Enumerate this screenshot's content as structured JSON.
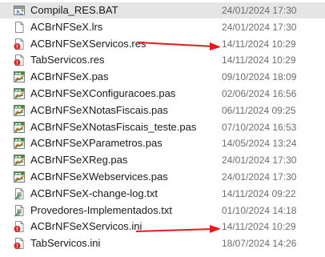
{
  "files": [
    {
      "name": "Compila_RES.BAT",
      "modified": "24/01/2024 17:30",
      "icon": "batch-file-icon",
      "selected": true
    },
    {
      "name": "ACBrNFSeX.lrs",
      "modified": "24/01/2024 17:30",
      "icon": "lrs-file-icon",
      "selected": false
    },
    {
      "name": "ACBrNFSeXServicos.res",
      "modified": "14/11/2024 10:29",
      "icon": "resource-file-icon",
      "selected": false
    },
    {
      "name": "TabServicos.res",
      "modified": "14/11/2024 10:29",
      "icon": "resource-file-icon",
      "selected": false
    },
    {
      "name": "ACBrNFSeX.pas",
      "modified": "09/10/2024 18:09",
      "icon": "pascal-file-icon",
      "selected": false
    },
    {
      "name": "ACBrNFSeXConfiguracoes.pas",
      "modified": "02/06/2024 16:56",
      "icon": "pascal-file-icon",
      "selected": false
    },
    {
      "name": "ACBrNFSeXNotasFiscais.pas",
      "modified": "06/11/2024 09:25",
      "icon": "pascal-file-icon",
      "selected": false
    },
    {
      "name": "ACBrNFSeXNotasFiscais_teste.pas",
      "modified": "07/10/2024 16:53",
      "icon": "pascal-file-icon",
      "selected": false
    },
    {
      "name": "ACBrNFSeXParametros.pas",
      "modified": "14/05/2024 13:24",
      "icon": "pascal-file-icon",
      "selected": false
    },
    {
      "name": "ACBrNFSeXReg.pas",
      "modified": "24/01/2024 17:30",
      "icon": "pascal-file-icon",
      "selected": false
    },
    {
      "name": "ACBrNFSeXWebservices.pas",
      "modified": "24/01/2024 17:30",
      "icon": "pascal-file-icon",
      "selected": false
    },
    {
      "name": "ACBrNFSeX-change-log.txt",
      "modified": "14/11/2024 09:22",
      "icon": "text-file-icon",
      "selected": false
    },
    {
      "name": "Provedores-Implementados.txt",
      "modified": "01/10/2024 14:18",
      "icon": "text-file-icon",
      "selected": false
    },
    {
      "name": "ACBrNFSeXServicos.ini",
      "modified": "14/11/2024 10:29",
      "icon": "ini-file-icon",
      "selected": false
    },
    {
      "name": "TabServicos.ini",
      "modified": "18/07/2024 14:26",
      "icon": "ini-file-icon",
      "selected": false
    }
  ],
  "annotations": {
    "arrow_color": "#e8191c",
    "arrow_targets": [
      "ACBrNFSeXServicos.res",
      "ACBrNFSeXServicos.ini"
    ]
  },
  "colors": {
    "selected_row": "#e5e5e5",
    "name_text": "#1a1a1a",
    "date_text": "#6d6d6d"
  }
}
